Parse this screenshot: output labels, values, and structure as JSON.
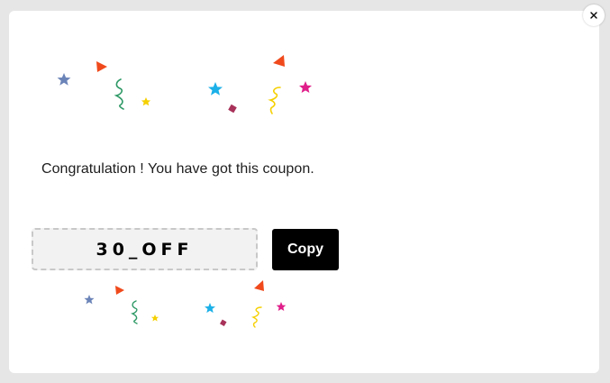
{
  "dialog": {
    "close_label": "×",
    "message": "Congratulation ! You have got this coupon.",
    "coupon_code": "30_OFF",
    "copy_label": "Copy"
  },
  "colors": {
    "star_blue_gray": "#6b84b8",
    "triangle_orange": "#f04a1c",
    "squiggle_green": "#2e9966",
    "star_yellow": "#f5d000",
    "star_cyan": "#1bb0e8",
    "square_maroon": "#a8325a",
    "squiggle_yellow": "#f5d000",
    "star_magenta": "#e01f8a"
  }
}
